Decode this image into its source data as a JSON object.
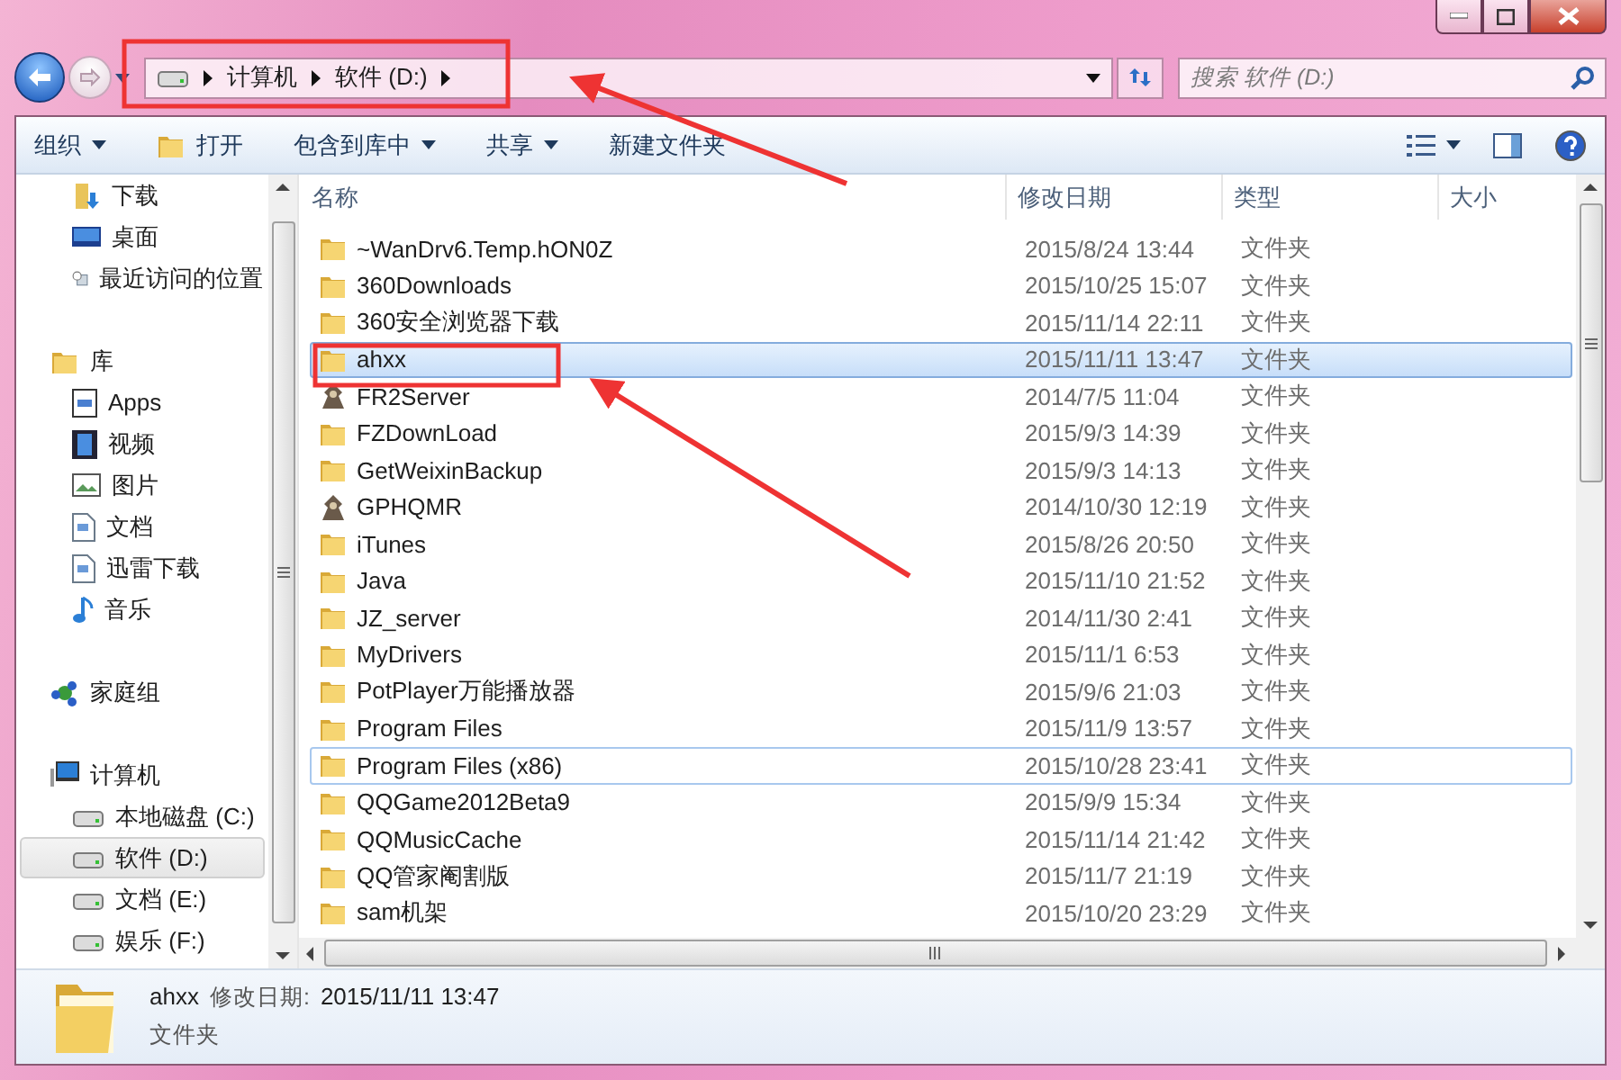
{
  "address_bar": {
    "segments": [
      "计算机",
      "软件 (D:)"
    ]
  },
  "search": {
    "placeholder": "搜索 软件 (D:)"
  },
  "toolbar": {
    "items": [
      {
        "label": "组织",
        "kind": "menu"
      },
      {
        "label": "打开",
        "kind": "open"
      },
      {
        "label": "包含到库中",
        "kind": "menu"
      },
      {
        "label": "共享",
        "kind": "menu"
      },
      {
        "label": "新建文件夹",
        "kind": "plain"
      }
    ]
  },
  "sidebar": {
    "groups": [
      {
        "children": [
          {
            "label": "下载",
            "kind": "downloads",
            "selected": false
          },
          {
            "label": "桌面",
            "kind": "desktop",
            "selected": false
          },
          {
            "label": "最近访问的位置",
            "kind": "recent",
            "selected": false
          }
        ]
      },
      {
        "label": "库",
        "kind": "library",
        "children": [
          {
            "label": "Apps",
            "kind": "apps",
            "selected": false
          },
          {
            "label": "视频",
            "kind": "video",
            "selected": false
          },
          {
            "label": "图片",
            "kind": "pictures",
            "selected": false
          },
          {
            "label": "文档",
            "kind": "documents",
            "selected": false
          },
          {
            "label": "迅雷下载",
            "kind": "documents",
            "selected": false
          },
          {
            "label": "音乐",
            "kind": "music",
            "selected": false
          }
        ]
      },
      {
        "label": "家庭组",
        "kind": "homegroup"
      },
      {
        "label": "计算机",
        "kind": "computer",
        "children": [
          {
            "label": "本地磁盘 (C:)",
            "kind": "system",
            "selected": false
          },
          {
            "label": "软件 (D:)",
            "kind": "drive",
            "selected": true
          },
          {
            "label": "文档 (E:)",
            "kind": "drive",
            "selected": false
          },
          {
            "label": "娱乐 (F:)",
            "kind": "drive",
            "selected": false
          }
        ]
      }
    ]
  },
  "table": {
    "columns": [
      "名称",
      "修改日期",
      "类型",
      "大小"
    ],
    "rows": [
      {
        "name": "~WanDrv6.Temp.hON0Z",
        "date": "2015/8/24 13:44",
        "type": "文件夹",
        "kind": "folder",
        "selected": false,
        "focused": false
      },
      {
        "name": "360Downloads",
        "date": "2015/10/25 15:07",
        "type": "文件夹",
        "kind": "folder",
        "selected": false,
        "focused": false
      },
      {
        "name": "360安全浏览器下载",
        "date": "2015/11/14 22:11",
        "type": "文件夹",
        "kind": "folder",
        "selected": false,
        "focused": false
      },
      {
        "name": "ahxx",
        "date": "2015/11/11 13:47",
        "type": "文件夹",
        "kind": "folder",
        "selected": true,
        "focused": false
      },
      {
        "name": "FR2Server",
        "date": "2014/7/5 11:04",
        "type": "文件夹",
        "kind": "app",
        "selected": false,
        "focused": false
      },
      {
        "name": "FZDownLoad",
        "date": "2015/9/3 14:39",
        "type": "文件夹",
        "kind": "folder",
        "selected": false,
        "focused": false
      },
      {
        "name": "GetWeixinBackup",
        "date": "2015/9/3 14:13",
        "type": "文件夹",
        "kind": "folder",
        "selected": false,
        "focused": false
      },
      {
        "name": "GPHQMR",
        "date": "2014/10/30 12:19",
        "type": "文件夹",
        "kind": "app",
        "selected": false,
        "focused": false
      },
      {
        "name": "iTunes",
        "date": "2015/8/26 20:50",
        "type": "文件夹",
        "kind": "folder",
        "selected": false,
        "focused": false
      },
      {
        "name": "Java",
        "date": "2015/11/10 21:52",
        "type": "文件夹",
        "kind": "folder",
        "selected": false,
        "focused": false
      },
      {
        "name": "JZ_server",
        "date": "2014/11/30 2:41",
        "type": "文件夹",
        "kind": "folder",
        "selected": false,
        "focused": false
      },
      {
        "name": "MyDrivers",
        "date": "2015/11/1 6:53",
        "type": "文件夹",
        "kind": "folder",
        "selected": false,
        "focused": false
      },
      {
        "name": "PotPlayer万能播放器",
        "date": "2015/9/6 21:03",
        "type": "文件夹",
        "kind": "folder",
        "selected": false,
        "focused": false
      },
      {
        "name": "Program Files",
        "date": "2015/11/9 13:57",
        "type": "文件夹",
        "kind": "folder",
        "selected": false,
        "focused": false
      },
      {
        "name": "Program Files (x86)",
        "date": "2015/10/28 23:41",
        "type": "文件夹",
        "kind": "folder",
        "selected": false,
        "focused": true
      },
      {
        "name": "QQGame2012Beta9",
        "date": "2015/9/9 15:34",
        "type": "文件夹",
        "kind": "folder",
        "selected": false,
        "focused": false
      },
      {
        "name": "QQMusicCache",
        "date": "2015/11/14 21:42",
        "type": "文件夹",
        "kind": "folder",
        "selected": false,
        "focused": false
      },
      {
        "name": "QQ管家阉割版",
        "date": "2015/11/7 21:19",
        "type": "文件夹",
        "kind": "folder",
        "selected": false,
        "focused": false
      },
      {
        "name": "sam机架",
        "date": "2015/10/20 23:29",
        "type": "文件夹",
        "kind": "folder",
        "selected": false,
        "focused": false
      }
    ]
  },
  "details": {
    "name": "ahxx",
    "date_label": "修改日期:",
    "date": "2015/11/11 13:47",
    "type": "文件夹"
  }
}
